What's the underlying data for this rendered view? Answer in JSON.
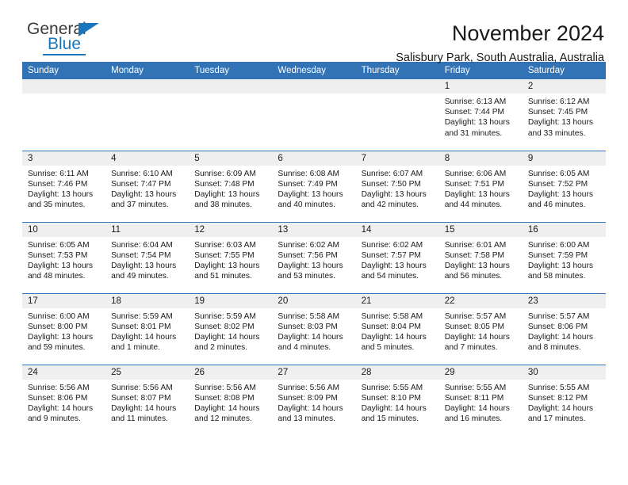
{
  "brand": {
    "name_top": "General",
    "name_bottom": "Blue",
    "accent_color": "#1b75bb"
  },
  "header": {
    "title": "November 2024",
    "subtitle": "Salisbury Park, South Australia, Australia"
  },
  "calendar": {
    "header_bg": "#3273b5",
    "daynum_bg": "#efefef",
    "weekdays": [
      "Sunday",
      "Monday",
      "Tuesday",
      "Wednesday",
      "Thursday",
      "Friday",
      "Saturday"
    ],
    "weeks": [
      [
        {
          "day": "",
          "empty": true
        },
        {
          "day": "",
          "empty": true
        },
        {
          "day": "",
          "empty": true
        },
        {
          "day": "",
          "empty": true
        },
        {
          "day": "",
          "empty": true
        },
        {
          "day": "1",
          "sunrise": "Sunrise: 6:13 AM",
          "sunset": "Sunset: 7:44 PM",
          "daylight": "Daylight: 13 hours and 31 minutes."
        },
        {
          "day": "2",
          "sunrise": "Sunrise: 6:12 AM",
          "sunset": "Sunset: 7:45 PM",
          "daylight": "Daylight: 13 hours and 33 minutes."
        }
      ],
      [
        {
          "day": "3",
          "sunrise": "Sunrise: 6:11 AM",
          "sunset": "Sunset: 7:46 PM",
          "daylight": "Daylight: 13 hours and 35 minutes."
        },
        {
          "day": "4",
          "sunrise": "Sunrise: 6:10 AM",
          "sunset": "Sunset: 7:47 PM",
          "daylight": "Daylight: 13 hours and 37 minutes."
        },
        {
          "day": "5",
          "sunrise": "Sunrise: 6:09 AM",
          "sunset": "Sunset: 7:48 PM",
          "daylight": "Daylight: 13 hours and 38 minutes."
        },
        {
          "day": "6",
          "sunrise": "Sunrise: 6:08 AM",
          "sunset": "Sunset: 7:49 PM",
          "daylight": "Daylight: 13 hours and 40 minutes."
        },
        {
          "day": "7",
          "sunrise": "Sunrise: 6:07 AM",
          "sunset": "Sunset: 7:50 PM",
          "daylight": "Daylight: 13 hours and 42 minutes."
        },
        {
          "day": "8",
          "sunrise": "Sunrise: 6:06 AM",
          "sunset": "Sunset: 7:51 PM",
          "daylight": "Daylight: 13 hours and 44 minutes."
        },
        {
          "day": "9",
          "sunrise": "Sunrise: 6:05 AM",
          "sunset": "Sunset: 7:52 PM",
          "daylight": "Daylight: 13 hours and 46 minutes."
        }
      ],
      [
        {
          "day": "10",
          "sunrise": "Sunrise: 6:05 AM",
          "sunset": "Sunset: 7:53 PM",
          "daylight": "Daylight: 13 hours and 48 minutes."
        },
        {
          "day": "11",
          "sunrise": "Sunrise: 6:04 AM",
          "sunset": "Sunset: 7:54 PM",
          "daylight": "Daylight: 13 hours and 49 minutes."
        },
        {
          "day": "12",
          "sunrise": "Sunrise: 6:03 AM",
          "sunset": "Sunset: 7:55 PM",
          "daylight": "Daylight: 13 hours and 51 minutes."
        },
        {
          "day": "13",
          "sunrise": "Sunrise: 6:02 AM",
          "sunset": "Sunset: 7:56 PM",
          "daylight": "Daylight: 13 hours and 53 minutes."
        },
        {
          "day": "14",
          "sunrise": "Sunrise: 6:02 AM",
          "sunset": "Sunset: 7:57 PM",
          "daylight": "Daylight: 13 hours and 54 minutes."
        },
        {
          "day": "15",
          "sunrise": "Sunrise: 6:01 AM",
          "sunset": "Sunset: 7:58 PM",
          "daylight": "Daylight: 13 hours and 56 minutes."
        },
        {
          "day": "16",
          "sunrise": "Sunrise: 6:00 AM",
          "sunset": "Sunset: 7:59 PM",
          "daylight": "Daylight: 13 hours and 58 minutes."
        }
      ],
      [
        {
          "day": "17",
          "sunrise": "Sunrise: 6:00 AM",
          "sunset": "Sunset: 8:00 PM",
          "daylight": "Daylight: 13 hours and 59 minutes."
        },
        {
          "day": "18",
          "sunrise": "Sunrise: 5:59 AM",
          "sunset": "Sunset: 8:01 PM",
          "daylight": "Daylight: 14 hours and 1 minute."
        },
        {
          "day": "19",
          "sunrise": "Sunrise: 5:59 AM",
          "sunset": "Sunset: 8:02 PM",
          "daylight": "Daylight: 14 hours and 2 minutes."
        },
        {
          "day": "20",
          "sunrise": "Sunrise: 5:58 AM",
          "sunset": "Sunset: 8:03 PM",
          "daylight": "Daylight: 14 hours and 4 minutes."
        },
        {
          "day": "21",
          "sunrise": "Sunrise: 5:58 AM",
          "sunset": "Sunset: 8:04 PM",
          "daylight": "Daylight: 14 hours and 5 minutes."
        },
        {
          "day": "22",
          "sunrise": "Sunrise: 5:57 AM",
          "sunset": "Sunset: 8:05 PM",
          "daylight": "Daylight: 14 hours and 7 minutes."
        },
        {
          "day": "23",
          "sunrise": "Sunrise: 5:57 AM",
          "sunset": "Sunset: 8:06 PM",
          "daylight": "Daylight: 14 hours and 8 minutes."
        }
      ],
      [
        {
          "day": "24",
          "sunrise": "Sunrise: 5:56 AM",
          "sunset": "Sunset: 8:06 PM",
          "daylight": "Daylight: 14 hours and 9 minutes."
        },
        {
          "day": "25",
          "sunrise": "Sunrise: 5:56 AM",
          "sunset": "Sunset: 8:07 PM",
          "daylight": "Daylight: 14 hours and 11 minutes."
        },
        {
          "day": "26",
          "sunrise": "Sunrise: 5:56 AM",
          "sunset": "Sunset: 8:08 PM",
          "daylight": "Daylight: 14 hours and 12 minutes."
        },
        {
          "day": "27",
          "sunrise": "Sunrise: 5:56 AM",
          "sunset": "Sunset: 8:09 PM",
          "daylight": "Daylight: 14 hours and 13 minutes."
        },
        {
          "day": "28",
          "sunrise": "Sunrise: 5:55 AM",
          "sunset": "Sunset: 8:10 PM",
          "daylight": "Daylight: 14 hours and 15 minutes."
        },
        {
          "day": "29",
          "sunrise": "Sunrise: 5:55 AM",
          "sunset": "Sunset: 8:11 PM",
          "daylight": "Daylight: 14 hours and 16 minutes."
        },
        {
          "day": "30",
          "sunrise": "Sunrise: 5:55 AM",
          "sunset": "Sunset: 8:12 PM",
          "daylight": "Daylight: 14 hours and 17 minutes."
        }
      ]
    ]
  }
}
